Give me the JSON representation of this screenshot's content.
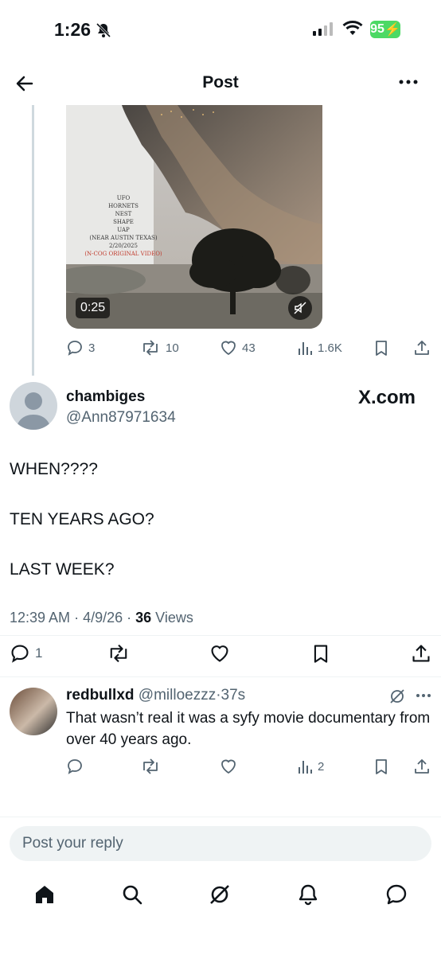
{
  "status_bar": {
    "time": "1:26",
    "battery": "95"
  },
  "header": {
    "title": "Post"
  },
  "quoted_post": {
    "video_overlay_lines": [
      "UFO",
      "HORNETS",
      "NEST",
      "SHAPE",
      "UAP",
      "(NEAR AUSTIN TEXAS)",
      "2/20/2025"
    ],
    "video_overlay_credit": "(N-COG ORIGINAL VIDEO)",
    "duration": "0:25",
    "replies": "3",
    "reposts": "10",
    "likes": "43",
    "views": "1.6K"
  },
  "post": {
    "author_name": "chambiges",
    "author_handle": "@Ann87971634",
    "watermark": "X.com",
    "lines": [
      "WHEN????",
      "TEN YEARS AGO?",
      "LAST WEEK?"
    ],
    "time": "12:39 AM",
    "date": "4/9/26",
    "views_count": "36",
    "views_label": "Views",
    "replies": "1"
  },
  "reply": {
    "name": "redbullxd",
    "handle": "@milloezzz",
    "age": "37s",
    "text": "That wasn’t real it was a syfy movie documentary from over 40 years ago.",
    "views": "2"
  },
  "composer": {
    "placeholder": "Post your reply"
  },
  "icons": [
    "back-arrow-icon",
    "more-icon",
    "comment-icon",
    "repost-icon",
    "like-icon",
    "views-icon",
    "bookmark-icon",
    "share-icon",
    "mute-icon",
    "home-icon",
    "search-icon",
    "grok-icon",
    "bell-icon",
    "message-icon"
  ]
}
